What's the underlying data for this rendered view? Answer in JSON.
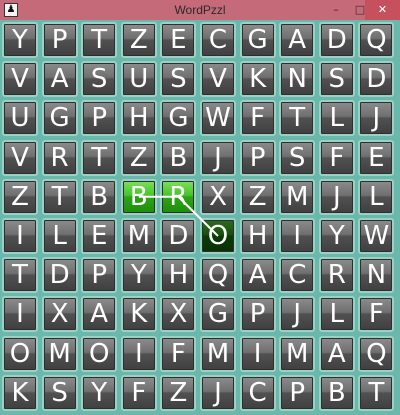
{
  "window": {
    "title": "WordPzzl",
    "app_icon_glyph": "♟",
    "minimize_glyph": "–",
    "maximize_glyph": "□",
    "close_glyph": "✕",
    "titlebar_color": "#c56a78",
    "close_color": "#c7505e"
  },
  "grid": {
    "rows": [
      [
        "Y",
        "P",
        "T",
        "Z",
        "E",
        "C",
        "G",
        "A",
        "D",
        "Q"
      ],
      [
        "V",
        "A",
        "S",
        "U",
        "S",
        "V",
        "K",
        "N",
        "S",
        "D"
      ],
      [
        "U",
        "G",
        "P",
        "H",
        "G",
        "W",
        "F",
        "T",
        "L",
        "J"
      ],
      [
        "V",
        "R",
        "T",
        "Z",
        "B",
        "J",
        "P",
        "S",
        "F",
        "E"
      ],
      [
        "Z",
        "T",
        "B",
        "B",
        "R",
        "X",
        "Z",
        "M",
        "J",
        "L"
      ],
      [
        "I",
        "L",
        "E",
        "M",
        "D",
        "O",
        "H",
        "I",
        "Y",
        "W"
      ],
      [
        "T",
        "D",
        "P",
        "Y",
        "H",
        "Q",
        "A",
        "C",
        "R",
        "N"
      ],
      [
        "I",
        "X",
        "A",
        "K",
        "X",
        "G",
        "P",
        "J",
        "L",
        "F"
      ],
      [
        "O",
        "M",
        "O",
        "I",
        "F",
        "M",
        "I",
        "M",
        "A",
        "Q"
      ],
      [
        "K",
        "S",
        "Y",
        "F",
        "Z",
        "J",
        "C",
        "P",
        "B",
        "T"
      ]
    ],
    "selected_path": [
      [
        4,
        3
      ],
      [
        4,
        4
      ],
      [
        5,
        5
      ]
    ],
    "selected_colors": {
      "light": "#46c32a",
      "dark": "#17520e"
    }
  }
}
